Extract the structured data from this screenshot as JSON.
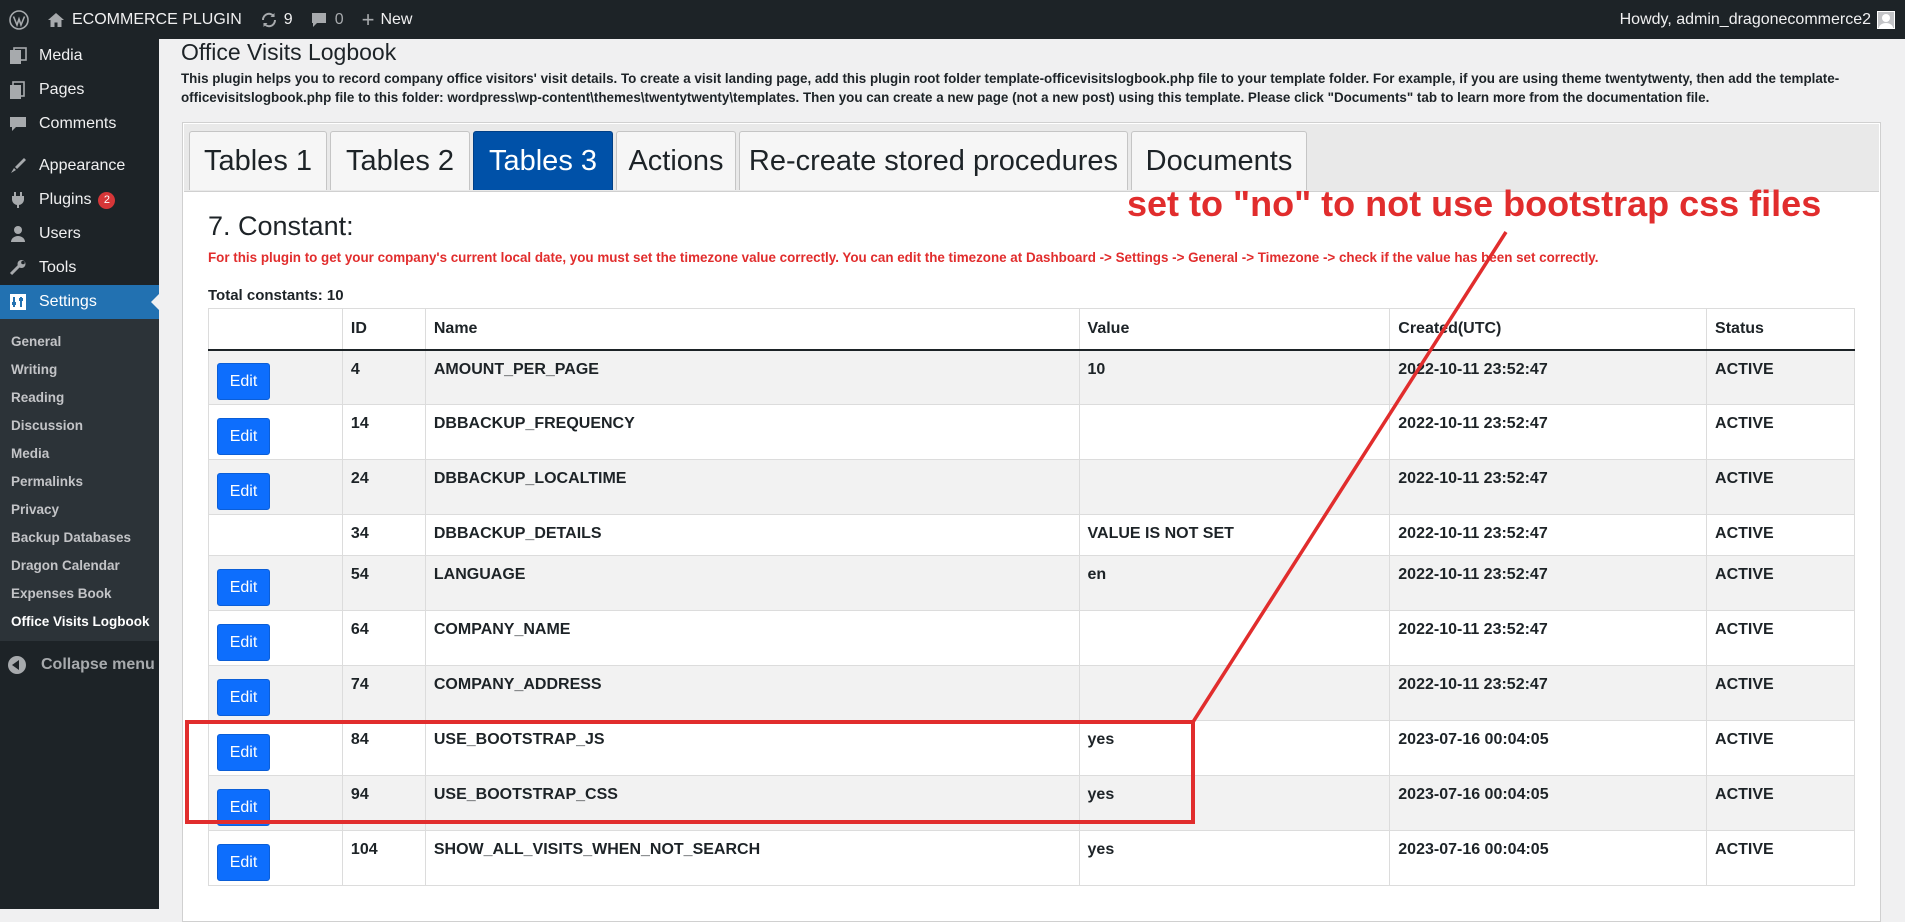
{
  "adminbar": {
    "site_name": "ECOMMERCE PLUGIN",
    "updates_count": "9",
    "comments_count": "0",
    "new_label": "New",
    "howdy": "Howdy, admin_dragonecommerce2"
  },
  "sidebar": {
    "items": [
      {
        "label": "Media",
        "icon": "media-icon"
      },
      {
        "label": "Pages",
        "icon": "pages-icon"
      },
      {
        "label": "Comments",
        "icon": "comments-icon"
      },
      {
        "label": "Appearance",
        "icon": "appearance-icon"
      },
      {
        "label": "Plugins",
        "icon": "plugins-icon",
        "badge": "2"
      },
      {
        "label": "Users",
        "icon": "users-icon"
      },
      {
        "label": "Tools",
        "icon": "tools-icon"
      },
      {
        "label": "Settings",
        "icon": "settings-icon"
      }
    ],
    "submenu": [
      "General",
      "Writing",
      "Reading",
      "Discussion",
      "Media",
      "Permalinks",
      "Privacy",
      "Backup Databases",
      "Dragon Calendar",
      "Expenses Book",
      "Office Visits Logbook"
    ],
    "collapse_label": "Collapse menu"
  },
  "page": {
    "title": "Office Visits Logbook",
    "intro": "This plugin helps you to record company office visitors' visit details. To create a visit landing page, add this plugin root folder template-officevisitslogbook.php file to your template folder. For example, if you are using theme twentytwenty, then add the template-officevisitslogbook.php file to this folder: wordpress\\wp-content\\themes\\twentytwenty\\templates. Then you can create a new page (not a new post) using this template. Please click \"Documents\" tab to learn more from the documentation file."
  },
  "tabs": [
    "Tables 1",
    "Tables 2",
    "Tables 3",
    "Actions",
    "Re-create stored procedures",
    "Documents"
  ],
  "active_tab": "Tables 3",
  "section": {
    "title": "7. Constant:",
    "warning": "For this plugin to get your company's current local date, you must set the timezone value correctly. You can edit the timezone at Dashboard -> Settings -> General -> Timezone -> check if the value has been set correctly.",
    "total": "Total constants: 10"
  },
  "table": {
    "headers": [
      "",
      "ID",
      "Name",
      "Value",
      "Created(UTC)",
      "Status"
    ],
    "edit_label": "Edit",
    "rows": [
      {
        "id": "4",
        "name": "AMOUNT_PER_PAGE",
        "value": "10",
        "created": "2022-10-11 23:52:47",
        "status": "ACTIVE",
        "editable": true
      },
      {
        "id": "14",
        "name": "DBBACKUP_FREQUENCY",
        "value": "",
        "created": "2022-10-11 23:52:47",
        "status": "ACTIVE",
        "editable": true
      },
      {
        "id": "24",
        "name": "DBBACKUP_LOCALTIME",
        "value": "",
        "created": "2022-10-11 23:52:47",
        "status": "ACTIVE",
        "editable": true
      },
      {
        "id": "34",
        "name": "DBBACKUP_DETAILS",
        "value": "VALUE IS NOT SET",
        "created": "2022-10-11 23:52:47",
        "status": "ACTIVE",
        "editable": false
      },
      {
        "id": "54",
        "name": "LANGUAGE",
        "value": "en",
        "created": "2022-10-11 23:52:47",
        "status": "ACTIVE",
        "editable": true
      },
      {
        "id": "64",
        "name": "COMPANY_NAME",
        "value": "",
        "created": "2022-10-11 23:52:47",
        "status": "ACTIVE",
        "editable": true
      },
      {
        "id": "74",
        "name": "COMPANY_ADDRESS",
        "value": "",
        "created": "2022-10-11 23:52:47",
        "status": "ACTIVE",
        "editable": true
      },
      {
        "id": "84",
        "name": "USE_BOOTSTRAP_JS",
        "value": "yes",
        "created": "2023-07-16 00:04:05",
        "status": "ACTIVE",
        "editable": true
      },
      {
        "id": "94",
        "name": "USE_BOOTSTRAP_CSS",
        "value": "yes",
        "created": "2023-07-16 00:04:05",
        "status": "ACTIVE",
        "editable": true
      },
      {
        "id": "104",
        "name": "SHOW_ALL_VISITS_WHEN_NOT_SEARCH",
        "value": "yes",
        "created": "2023-07-16 00:04:05",
        "status": "ACTIVE",
        "editable": true
      }
    ]
  },
  "annotation": {
    "text": "set to \"no\" to not use bootstrap css files",
    "color": "#e12d2d"
  },
  "colors": {
    "admin_bg": "#1d2327",
    "accent": "#2271b1",
    "active_tab": "#0051a8",
    "edit_button": "#0d6efd",
    "annotation": "#e12d2d"
  }
}
